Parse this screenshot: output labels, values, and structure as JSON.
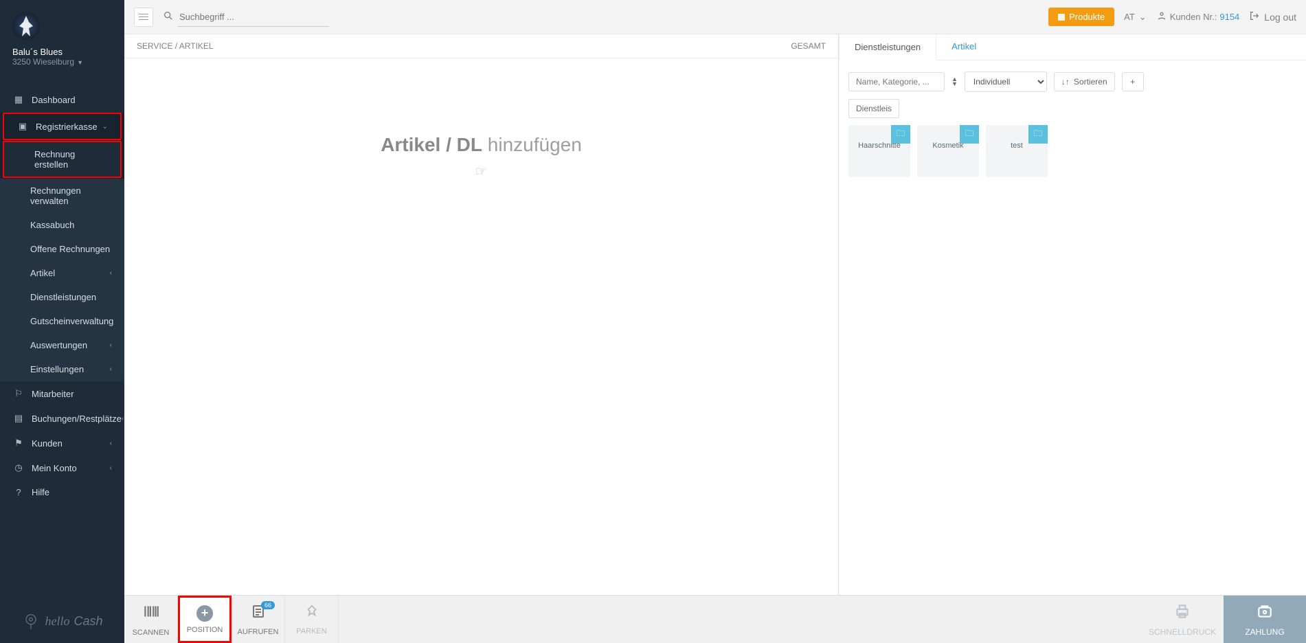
{
  "brand": {
    "name": "Balu´s Blues",
    "sub": "3250 Wieselburg"
  },
  "topbar": {
    "search_placeholder": "Suchbegriff ...",
    "products_btn": "Produkte",
    "region": "AT",
    "cust_label": "Kunden Nr.:",
    "cust_no": "9154",
    "logout": "Log out"
  },
  "nav": {
    "dashboard": "Dashboard",
    "register": "Registrierkasse",
    "sub": {
      "create": "Rechnung erstellen",
      "manage": "Rechnungen verwalten",
      "cashbook": "Kassabuch",
      "open": "Offene Rechnungen",
      "items": "Artikel",
      "services": "Dienstleistungen",
      "vouchers": "Gutscheinverwaltung",
      "reports": "Auswertungen",
      "settings": "Einstellungen"
    },
    "staff": "Mitarbeiter",
    "bookings": "Buchungen/Restplätze",
    "customers": "Kunden",
    "account": "Mein Konto",
    "help": "Hilfe",
    "logo_hello": "hello",
    "logo_cash": "Cash"
  },
  "invoice": {
    "col_service": "SERVICE / ARTIKEL",
    "col_total": "GESAMT",
    "empty_strong": "Artikel / DL",
    "empty_rest": " hinzufügen"
  },
  "catalog": {
    "tab_services": "Dienstleistungen",
    "tab_items": "Artikel",
    "filter_placeholder": "Name, Kategorie, ...",
    "select_value": "Individuell",
    "sort_label": "Sortieren",
    "chip": "Dienstleis",
    "cards": [
      {
        "label": "Haarschnitte"
      },
      {
        "label": "Kosmetik"
      },
      {
        "label": "test"
      }
    ]
  },
  "footer": {
    "scan": "SCANNEN",
    "position": "POSITION",
    "aufrufen": "AUFRUFEN",
    "aufrufen_badge": "66",
    "parken": "PARKEN",
    "schnelldruck": "SCHNELLDRUCK",
    "zahlung": "ZAHLUNG"
  }
}
